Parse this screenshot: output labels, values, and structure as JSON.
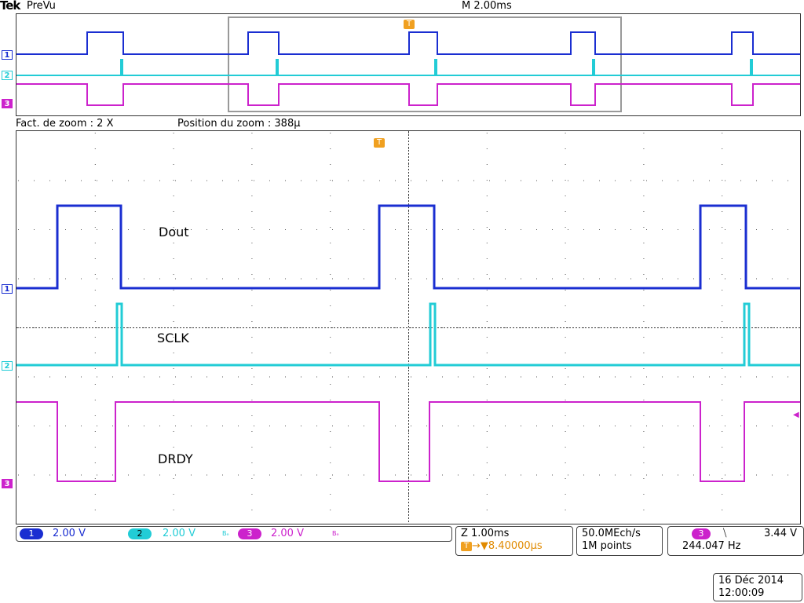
{
  "header": {
    "brand": "Tek",
    "mode": "PreVu",
    "timebase": "M 2.00ms"
  },
  "zoom": {
    "factor_label": "Fact. de zoom : 2 X",
    "position_label": "Position du zoom  : 388μ"
  },
  "trigger_marker": "T",
  "channels": [
    {
      "id": "1",
      "marker": "1",
      "color": "#1a2ed1",
      "scale": "2.00 V",
      "chip": "1"
    },
    {
      "id": "2",
      "marker": "2",
      "color": "#22ccd6",
      "scale": "2.00 V",
      "chip": "2",
      "bw": "Bₑ"
    },
    {
      "id": "3",
      "marker": "3",
      "color": "#cc22cc",
      "scale": "2.00 V",
      "chip": "3",
      "bw": "Bₑ"
    }
  ],
  "signals": {
    "dout": "Dout",
    "sclk": "SCLK",
    "drdy": "DRDY"
  },
  "status": {
    "zoom_time": "Z 1.00ms",
    "trigger_delay": "▼8.40000μs",
    "sample_rate": "50.0MEch/s",
    "record_length": "1M points",
    "trigger_source": "3",
    "trigger_slope": "⧹",
    "trigger_level": "3.44 V",
    "frequency": "244.047 Hz",
    "date": "16 Déc  2014",
    "time": "12:00:09"
  },
  "colors": {
    "ch1": "#1a2ed1",
    "ch2": "#22ccd6",
    "ch3": "#cc22cc",
    "trigger": "#f0a020",
    "grid": "#333333"
  }
}
